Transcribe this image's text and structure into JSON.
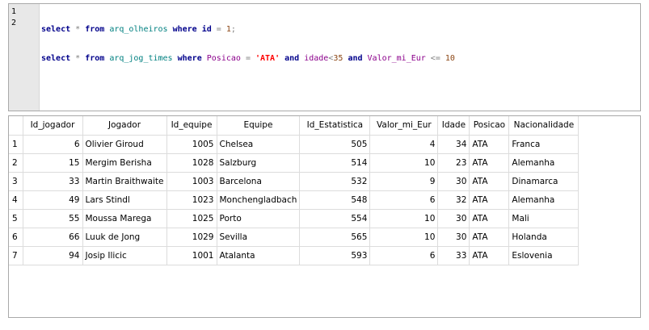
{
  "editor": {
    "line_numbers": [
      "1",
      "2"
    ],
    "line1": {
      "t1": "select",
      "t2": " * ",
      "t3": "from",
      "t4": " ",
      "t5": "arq_olheiros",
      "t6": " ",
      "t7": "where",
      "t8": " ",
      "t9": "id",
      "t10": " = ",
      "t11": "1",
      "t12": ";"
    },
    "line2": {
      "t1": "select",
      "t2": " * ",
      "t3": "from",
      "t4": " ",
      "t5": "arq_jog_times",
      "t6": " ",
      "t7": "where",
      "t8": " ",
      "t9": "Posicao",
      "t10": " = ",
      "t11": "'ATA'",
      "t12": " ",
      "t13": "and",
      "t14": " ",
      "t15": "idade",
      "t16": "<",
      "t17": "35",
      "t18": " ",
      "t19": "and",
      "t20": " ",
      "t21": "Valor_mi_Eur",
      "t22": " <= ",
      "t23": "10"
    }
  },
  "results": {
    "columns": [
      "Id_jogador",
      "Jogador",
      "Id_equipe",
      "Equipe",
      "Id_Estatistica",
      "Valor_mi_Eur",
      "Idade",
      "Posicao",
      "Nacionalidade"
    ],
    "rows": [
      {
        "n": "1",
        "cells": [
          "6",
          "Olivier Giroud",
          "1005",
          "Chelsea",
          "505",
          "4",
          "34",
          "ATA",
          "Franca"
        ]
      },
      {
        "n": "2",
        "cells": [
          "15",
          "Mergim Berisha",
          "1028",
          "Salzburg",
          "514",
          "10",
          "23",
          "ATA",
          "Alemanha"
        ]
      },
      {
        "n": "3",
        "cells": [
          "33",
          "Martin Braithwaite",
          "1003",
          "Barcelona",
          "532",
          "9",
          "30",
          "ATA",
          "Dinamarca"
        ]
      },
      {
        "n": "4",
        "cells": [
          "49",
          "Lars Stindl",
          "1023",
          "Monchengladbach",
          "548",
          "6",
          "32",
          "ATA",
          "Alemanha"
        ]
      },
      {
        "n": "5",
        "cells": [
          "55",
          "Moussa Marega",
          "1025",
          "Porto",
          "554",
          "10",
          "30",
          "ATA",
          "Mali"
        ]
      },
      {
        "n": "6",
        "cells": [
          "66",
          "Luuk de Jong",
          "1029",
          "Sevilla",
          "565",
          "10",
          "30",
          "ATA",
          "Holanda"
        ]
      },
      {
        "n": "7",
        "cells": [
          "94",
          "Josip Ilicic",
          "1001",
          "Atalanta",
          "593",
          "6",
          "33",
          "ATA",
          "Eslovenia"
        ]
      }
    ]
  }
}
